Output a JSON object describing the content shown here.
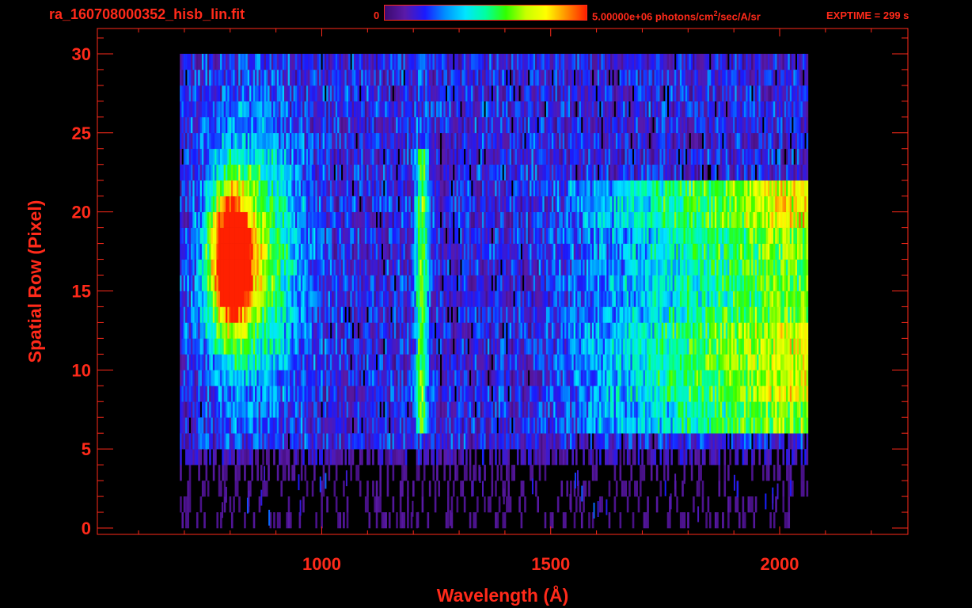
{
  "header": {
    "filename": "ra_160708000352_hisb_lin.fit",
    "colorbar_min": "0",
    "colorbar_max_value": "5.00000e+06 photons/cm",
    "colorbar_max_sup": "2",
    "colorbar_max_tail": "/sec/A/sr",
    "exptime": "EXPTIME = 299 s"
  },
  "colors": {
    "axis": "#ff2a1a",
    "background": "#000000",
    "colormap": [
      "#000000",
      "#3b0a6e",
      "#5a1aa8",
      "#1a1aff",
      "#0090ff",
      "#00e5ff",
      "#00ffa0",
      "#30ff00",
      "#c8ff00",
      "#ffff00",
      "#ff9000",
      "#ff2000"
    ]
  },
  "chart_data": {
    "type": "heatmap",
    "title": "ra_160708000352_hisb_lin.fit",
    "xlabel": "Wavelength (Å)",
    "ylabel": "Spatial Row (Pixel)",
    "xlim": [
      510,
      2280
    ],
    "ylim": [
      -0.4,
      31.6
    ],
    "x_ticks": [
      1000,
      1500,
      2000
    ],
    "y_ticks": [
      0,
      5,
      10,
      15,
      20,
      25,
      30
    ],
    "x_tick_labels": [
      "1000",
      "1500",
      "2000"
    ],
    "y_tick_labels": [
      "0",
      "5",
      "10",
      "15",
      "20",
      "25",
      "30"
    ],
    "grid": false,
    "x_range_data": [
      680,
      2065
    ],
    "y_range_data": [
      0,
      30
    ],
    "colorbar_range": [
      0,
      5000000
    ],
    "colorbar_unit": "photons/cm^2/sec/A/sr",
    "exposure_s": 299,
    "features": [
      {
        "name": "strong emission",
        "wavelength_center": 790,
        "rows": [
          13,
          21
        ],
        "level": 1.0
      },
      {
        "name": "diffuse emission",
        "wavelength_range": [
          720,
          930
        ],
        "rows": [
          10,
          24
        ],
        "level": 0.55
      },
      {
        "name": "Lyman-alpha line",
        "wavelength_center": 1216,
        "rows": [
          6,
          24
        ],
        "level": 0.6
      },
      {
        "name": "continuum",
        "wavelength_range": [
          1500,
          2065
        ],
        "rows": [
          6,
          22
        ],
        "level": 0.6
      }
    ]
  }
}
